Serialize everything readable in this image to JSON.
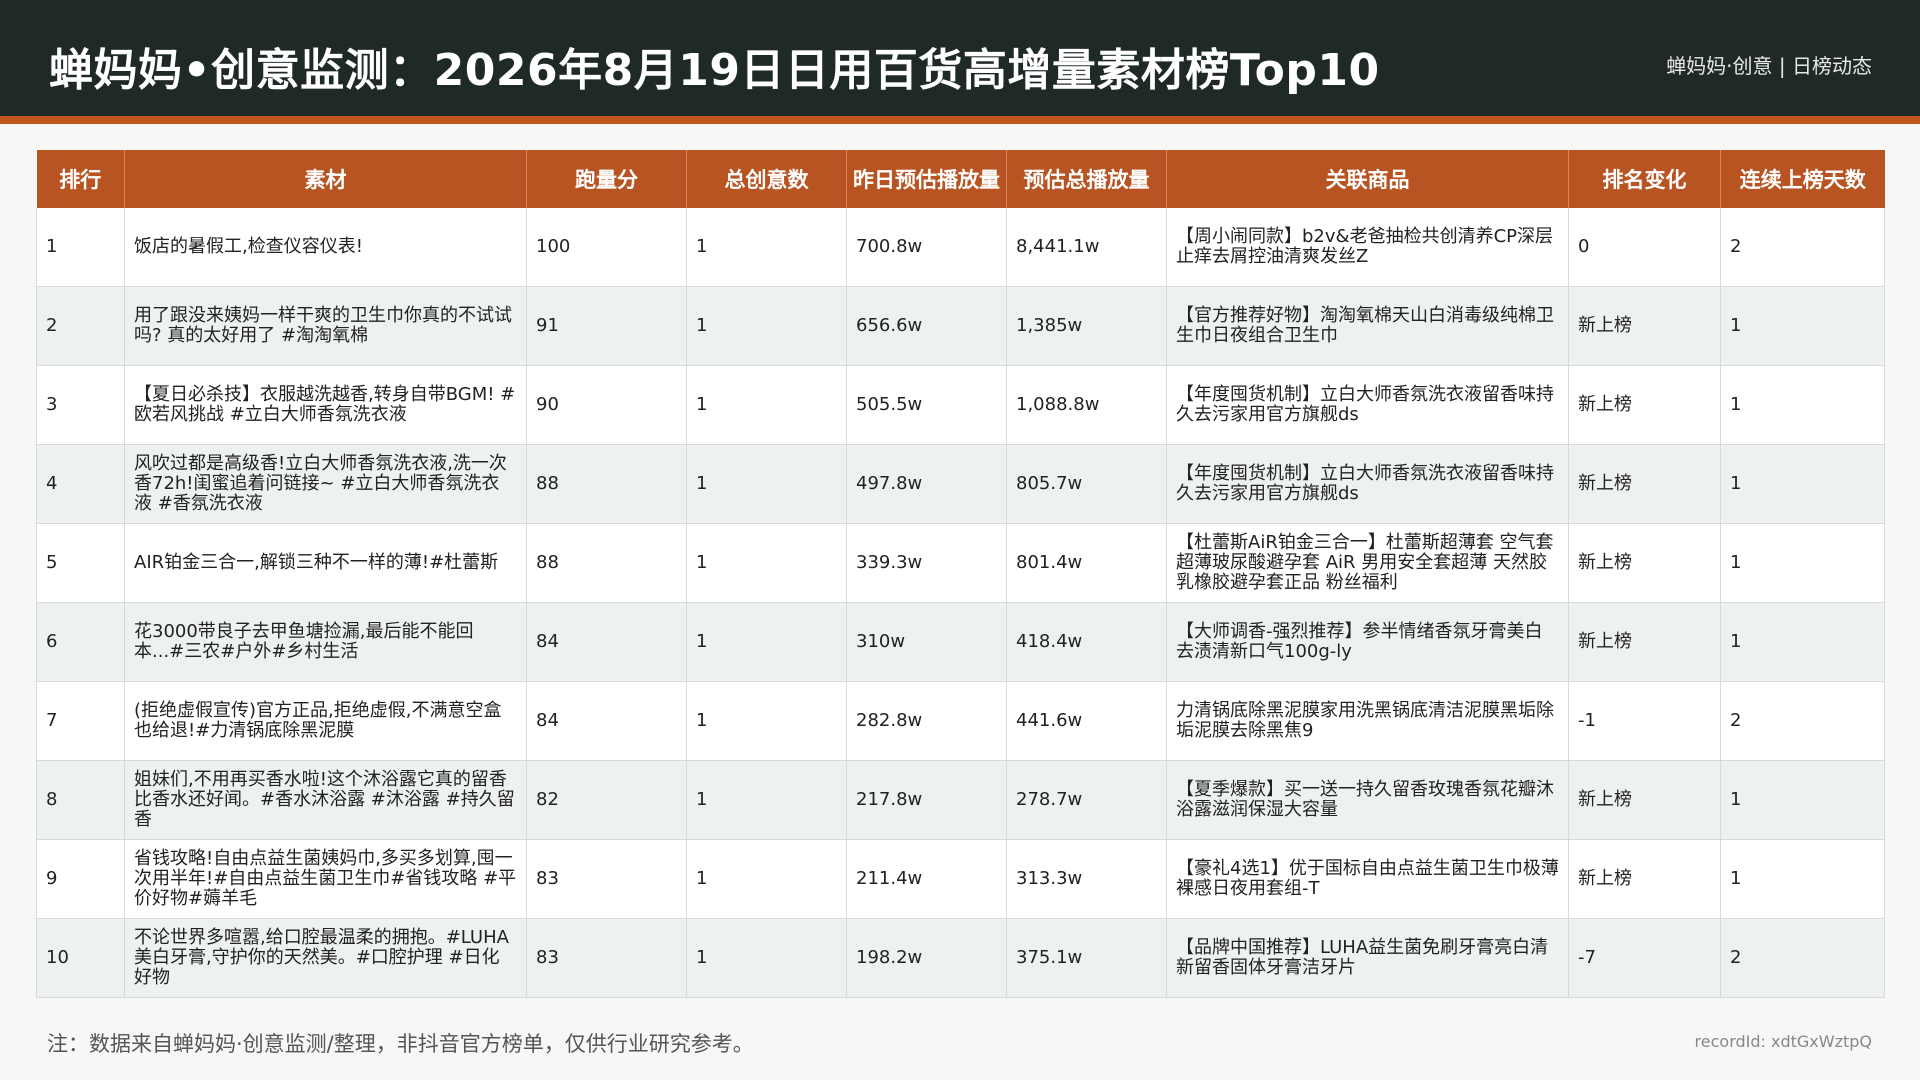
{
  "header": {
    "title": "蝉妈妈•创意监测：2026年8月19日日用百货高增量素材榜Top10",
    "right_text": "蝉妈妈·创意 | 日榜动态"
  },
  "colors": {
    "header_bg": "#1f2a26",
    "accent": "#c0571d",
    "table_header_bg": "#b85422",
    "row_alt_bg": "#eef2ef"
  },
  "table": {
    "columns": [
      "排行",
      "素材",
      "跑量分",
      "总创意数",
      "昨日预估播放量",
      "预估总播放量",
      "关联商品",
      "排名变化",
      "连续上榜天数"
    ],
    "rows": [
      [
        "1",
        "饭店的暑假工,检查仪容仪表!",
        "100",
        "1",
        "700.8w",
        "8,441.1w",
        "【周小闹同款】b2v&老爸抽检共创清养CP深层止痒去屑控油清爽发丝Z",
        "0",
        "2"
      ],
      [
        "2",
        "用了跟没来姨妈一样干爽的卫生巾你真的不试试吗? 真的太好用了 #淘淘氧棉",
        "91",
        "1",
        "656.6w",
        "1,385w",
        "【官方推荐好物】淘淘氧棉天山白消毒级纯棉卫生巾日夜组合卫生巾",
        "新上榜",
        "1"
      ],
      [
        "3",
        "【夏日必杀技】衣服越洗越香,转身自带BGM! #欧若风挑战 #立白大师香氛洗衣液",
        "90",
        "1",
        "505.5w",
        "1,088.8w",
        "【年度囤货机制】立白大师香氛洗衣液留香味持久去污家用官方旗舰ds",
        "新上榜",
        "1"
      ],
      [
        "4",
        "风吹过都是高级香!立白大师香氛洗衣液,洗一次香72h!闺蜜追着问链接~ #立白大师香氛洗衣液 #香氛洗衣液",
        "88",
        "1",
        "497.8w",
        "805.7w",
        "【年度囤货机制】立白大师香氛洗衣液留香味持久去污家用官方旗舰ds",
        "新上榜",
        "1"
      ],
      [
        "5",
        "AIR铂金三合一,解锁三种不一样的薄!#杜蕾斯",
        "88",
        "1",
        "339.3w",
        "801.4w",
        "【杜蕾斯AiR铂金三合一】杜蕾斯超薄套 空气套 超薄玻尿酸避孕套 AiR 男用安全套超薄 天然胶乳橡胶避孕套正品 粉丝福利",
        "新上榜",
        "1"
      ],
      [
        "6",
        "花3000带良子去甲鱼塘捡漏,最后能不能回本...#三农#户外#乡村生活",
        "84",
        "1",
        "310w",
        "418.4w",
        "【大师调香-强烈推荐】参半情绪香氛牙膏美白去渍清新口气100g-ly",
        "新上榜",
        "1"
      ],
      [
        "7",
        "(拒绝虚假宣传)官方正品,拒绝虚假,不满意空盒也给退!#力清锅底除黑泥膜",
        "84",
        "1",
        "282.8w",
        "441.6w",
        "力清锅底除黑泥膜家用洗黑锅底清洁泥膜黑垢除垢泥膜去除黑焦9",
        "-1",
        "2"
      ],
      [
        "8",
        "姐妹们,不用再买香水啦!这个沐浴露它真的留香比香水还好闻。#香水沐浴露 #沐浴露 #持久留香",
        "82",
        "1",
        "217.8w",
        "278.7w",
        "【夏季爆款】买一送一持久留香玫瑰香氛花瓣沐浴露滋润保湿大容量",
        "新上榜",
        "1"
      ],
      [
        "9",
        "省钱攻略!自由点益生菌姨妈巾,多买多划算,囤一次用半年!#自由点益生菌卫生巾#省钱攻略 #平价好物#薅羊毛",
        "83",
        "1",
        "211.4w",
        "313.3w",
        "【豪礼4选1】优于国标自由点益生菌卫生巾极薄裸感日夜用套组-T",
        "新上榜",
        "1"
      ],
      [
        "10",
        "不论世界多喧嚣,给口腔最温柔的拥抱。#LUHA美白牙膏,守护你的天然美。#口腔护理 #日化好物",
        "83",
        "1",
        "198.2w",
        "375.1w",
        "【品牌中国推荐】LUHA益生菌免刷牙膏亮白清新留香固体牙膏洁牙片",
        "-7",
        "2"
      ]
    ]
  },
  "footer": {
    "note": "注：数据来自蝉妈妈·创意监测/整理，非抖音官方榜单，仅供行业研究参考。",
    "record_id": "recordId: xdtGxWztpQ"
  }
}
